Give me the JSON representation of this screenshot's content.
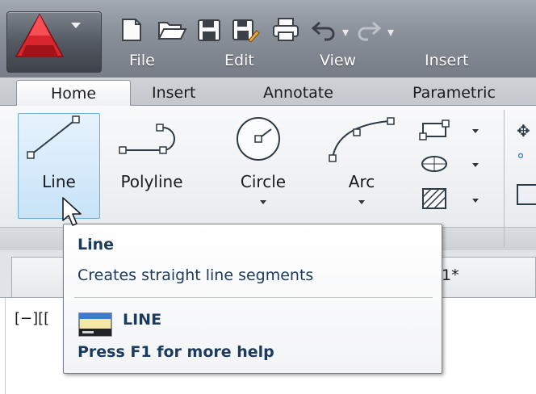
{
  "menubar": {
    "items": [
      "File",
      "Edit",
      "View",
      "Insert"
    ]
  },
  "ribbon": {
    "tabs": [
      "Home",
      "Insert",
      "Annotate",
      "Parametric"
    ],
    "active_tab": "Home",
    "tools": {
      "line": "Line",
      "polyline": "Polyline",
      "circle": "Circle",
      "arc": "Arc"
    }
  },
  "document_tab": {
    "label": "1*"
  },
  "viewport": {
    "controls": "[−][["
  },
  "tooltip": {
    "title": "Line",
    "description": "Creates straight line segments",
    "command": "LINE",
    "help": "Press F1 for more help"
  },
  "colors": {
    "accent": "#c8e3f8",
    "titlebar": "#888f98",
    "logo_red": "#d9262e",
    "tooltip_text": "#1b3a5c"
  }
}
